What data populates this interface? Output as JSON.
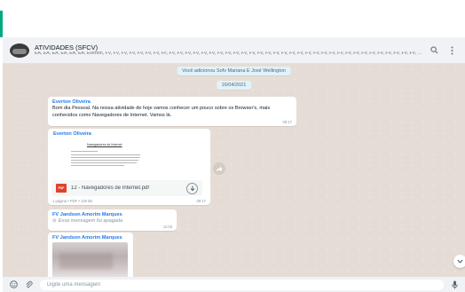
{
  "header": {
    "chat_name": "ATIVIDADES (SFCV)",
    "members": "EA, EA, EA, EA, EA, EA, Everton, FV, FV, FV, FV, FV, FV, FV, Fc, FV, FV, FV, FV, FV, FV, FV, FV, FV, FV, FV, FV, FV, FV, FV, FV, FV, FV, FV, FV, FV, FV, FV, FV, FV, FV, FV, FV, FV, FV, FV, FV, FV, FV, FV, FV,..."
  },
  "chat": {
    "system_added": "Você adicionou Sofv Mariana E José Wellington",
    "date_chip": "16/04/2021",
    "msg1": {
      "sender": "Everton Oliveira",
      "text": "Bom dia Pessoal. Na nossa atividade de hoje vamos conhecer um pouco sobre os Browser's, mais conhecidos como Navegadores de Internet. Vamos lá.",
      "time": "09:17"
    },
    "msg2": {
      "sender": "Everton Oliveira",
      "preview_title": "Navegadores de Internet",
      "file_name": "12 - Navegadores de Internet.pdf",
      "file_meta": "1 página • PDF • 130 kB",
      "time": "09:17",
      "pdf_badge": "PDF"
    },
    "msg3": {
      "sender": "FV Jandson Amorim Marques",
      "text": "Essa mensagem foi apagada",
      "time": "11:03"
    },
    "msg4": {
      "sender": "FV Jandson Amorim Marques"
    }
  },
  "footer": {
    "placeholder": "Digite uma mensagem"
  },
  "icons": {
    "search": "search-icon",
    "menu": "menu-icon",
    "emoji": "emoji-icon",
    "attach": "paperclip-icon",
    "mic": "microphone-icon",
    "download": "download-icon",
    "forward": "forward-icon",
    "scroll": "chevron-down-icon",
    "deleted": "blocked-icon"
  },
  "colors": {
    "accent": "#00a884",
    "chat_bg": "#e5ddd5",
    "sender": "#1f7aec",
    "system_chip": "#e1f2fb"
  }
}
